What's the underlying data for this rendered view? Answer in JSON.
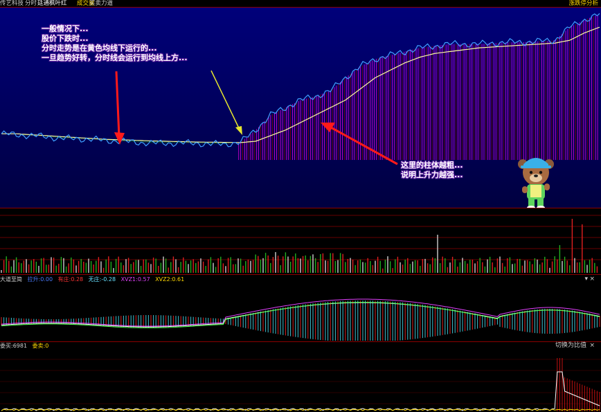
{
  "header": {
    "app_name": "传艺科技",
    "mode": "分时",
    "stock_name": "廷通枫叶红",
    "tabs": [
      "成交量",
      "买卖力道"
    ],
    "right_tool": "涨跌停分析"
  },
  "annotations": {
    "left": [
      "一般情况下...",
      "股价下跌时...",
      "分时走势是在黄色均线下运行的...",
      "一旦趋势好转，分时线会运行到均线上方..."
    ],
    "right": [
      "这里的柱体越粗...",
      "说明上升力越强..."
    ]
  },
  "macd_panel": {
    "title": "大道至简",
    "items": [
      {
        "label": "拉升:",
        "value": "0.00",
        "color": "#4a7bff"
      },
      {
        "label": "有庄:",
        "value": "0.28",
        "color": "#ff3333"
      },
      {
        "label": "无庄:",
        "value": "-0.28",
        "color": "#66e0ff"
      },
      {
        "label": "XVZ1:",
        "value": "0.57",
        "color": "#e040fb"
      },
      {
        "label": "XVZ2:",
        "value": "0.61",
        "color": "#ffd800"
      }
    ],
    "menu_icon": "dropdown-arrow-icon",
    "close_icon": "close-icon"
  },
  "bs_panel": {
    "buy_label": "委买:6981",
    "sell_label": "委卖:0",
    "switch_label": "切换为比值",
    "close_icon": "close-icon"
  },
  "colors": {
    "bg_main_top": "#00006e",
    "bg_main_bottom": "#000040",
    "price_line": "#4aa3ff",
    "avg_line": "#ffffa0",
    "fill_up": "#cc00cc",
    "fill_up_dark": "#800000",
    "fill_down": "#008000",
    "arrow": "#ff2020",
    "arrow_yellow": "#e6e62e",
    "grid": "#8b0000"
  },
  "chart_data": [
    {
      "type": "line",
      "x": [
        0,
        6,
        12,
        18,
        24,
        30,
        36,
        42,
        48,
        54,
        60,
        66,
        72,
        78,
        84,
        90,
        96,
        102,
        108,
        114,
        120,
        126,
        132,
        138,
        144,
        150,
        156,
        162,
        168,
        174,
        180,
        186,
        192,
        198,
        204,
        210,
        216,
        222,
        228,
        234,
        240
      ],
      "series": [
        {
          "values": [
            0.2,
            0.15,
            0.1,
            0.05,
            -0.05,
            -0.05,
            -0.1,
            -0.15,
            -0.2,
            -0.25,
            -0.3,
            -0.3,
            -0.3,
            -0.3,
            -0.35,
            -0.35,
            -0.25,
            0.4,
            1.2,
            1.6,
            2.0,
            2.2,
            2.5,
            3.2,
            3.8,
            4.2,
            4.4,
            4.6,
            4.8,
            4.9,
            5.0,
            5.0,
            5.0,
            5.05,
            5.1,
            5.1,
            5.15,
            5.2,
            5.9,
            6.3,
            6.6
          ]
        },
        {
          "values": [
            0.2,
            0.2,
            0.15,
            0.1,
            0.05,
            0.0,
            -0.05,
            -0.1,
            -0.12,
            -0.15,
            -0.18,
            -0.2,
            -0.22,
            -0.24,
            -0.25,
            -0.26,
            -0.27,
            -0.2,
            0.1,
            0.4,
            0.8,
            1.2,
            1.6,
            2.0,
            2.6,
            3.2,
            3.6,
            4.0,
            4.3,
            4.5,
            4.6,
            4.7,
            4.8,
            4.85,
            4.9,
            4.95,
            5.0,
            5.05,
            5.2,
            5.6,
            5.9
          ]
        }
      ]
    },
    {
      "type": "bar",
      "x": [
        0,
        240
      ],
      "series": [
        {
          "name": "成交量",
          "values": []
        }
      ]
    }
  ]
}
